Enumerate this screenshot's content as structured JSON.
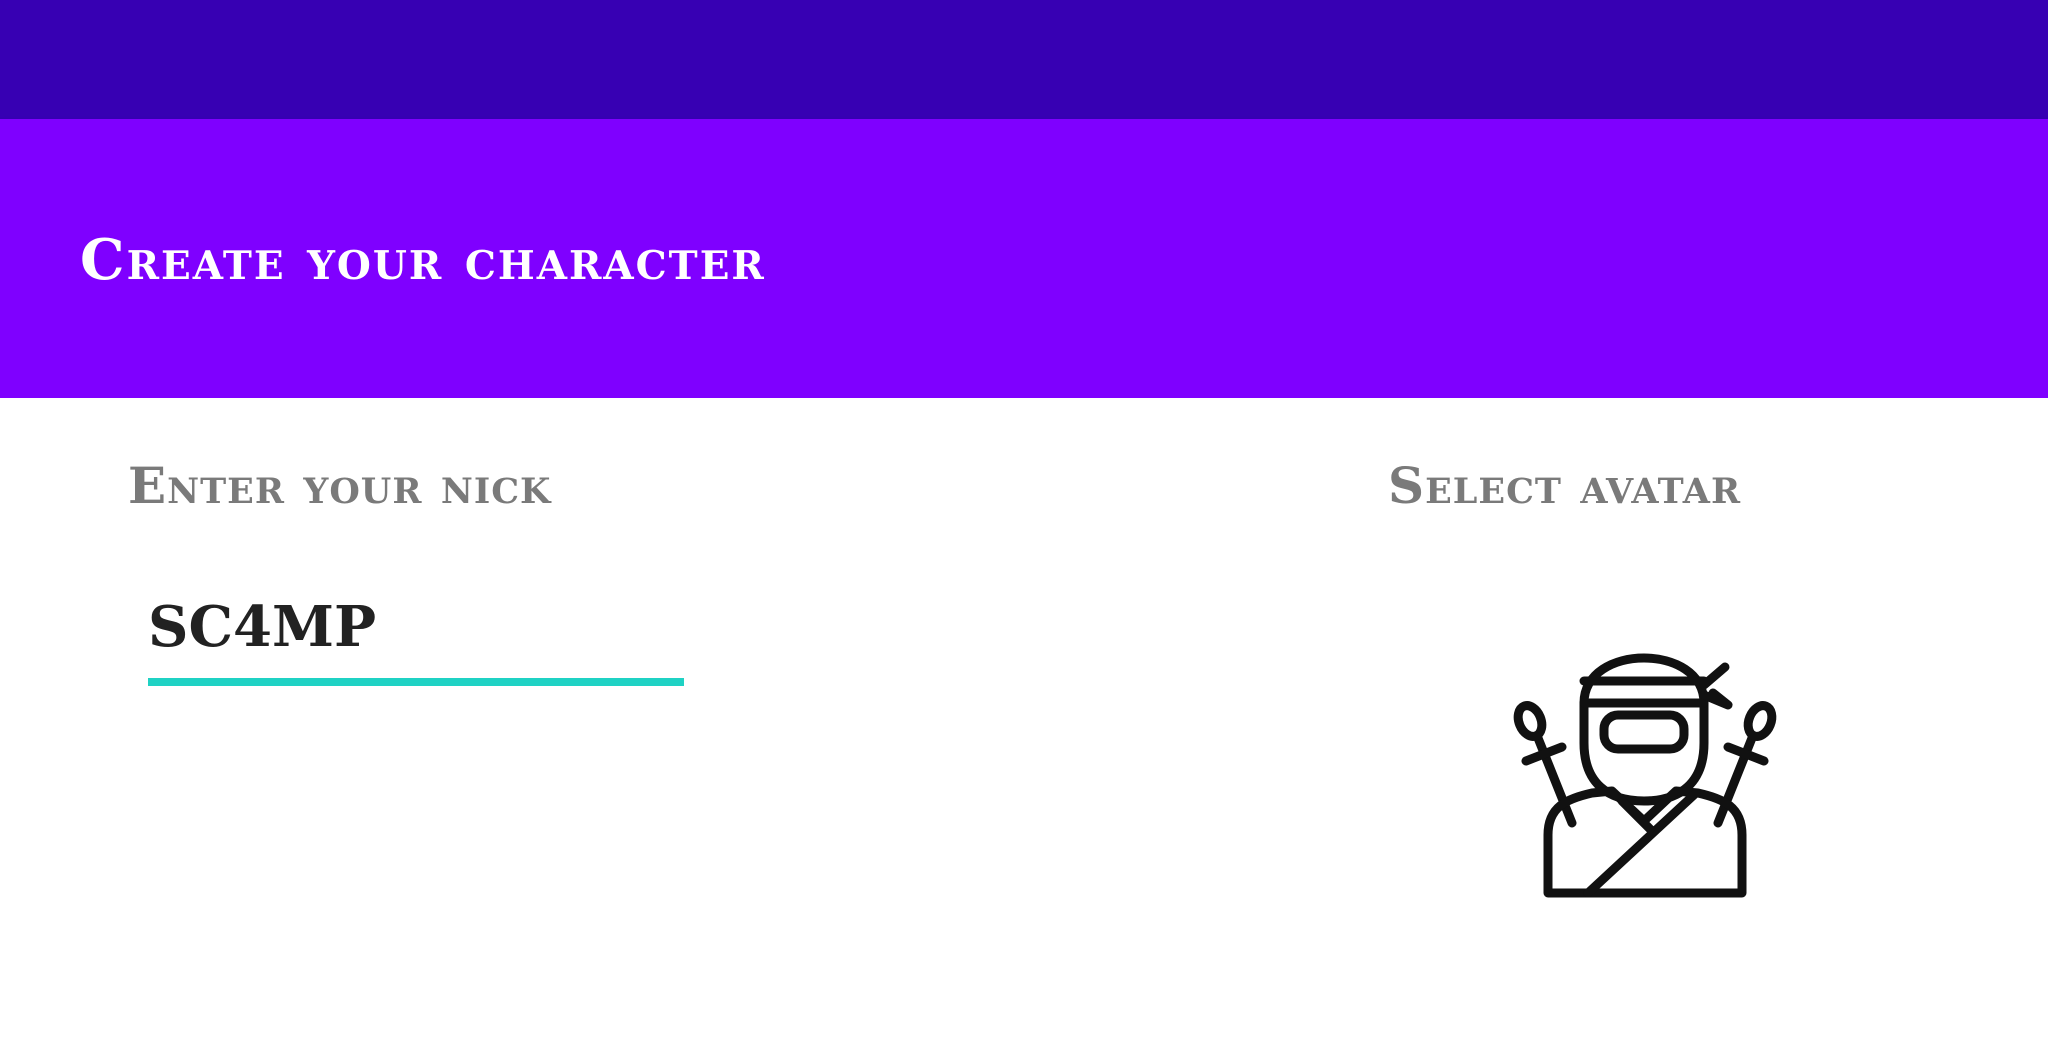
{
  "app_bar": {
    "title": "Create Your Character"
  },
  "nick": {
    "label": "Enter Your Nick",
    "value": "SC4MP"
  },
  "avatar": {
    "label": "Select Avatar",
    "icon": "ninja-icon"
  },
  "colors": {
    "status_bar": "#3700b3",
    "app_bar": "#7f00ff",
    "input_underline": "#1fd2c4",
    "label_text": "#7a7a7a"
  }
}
